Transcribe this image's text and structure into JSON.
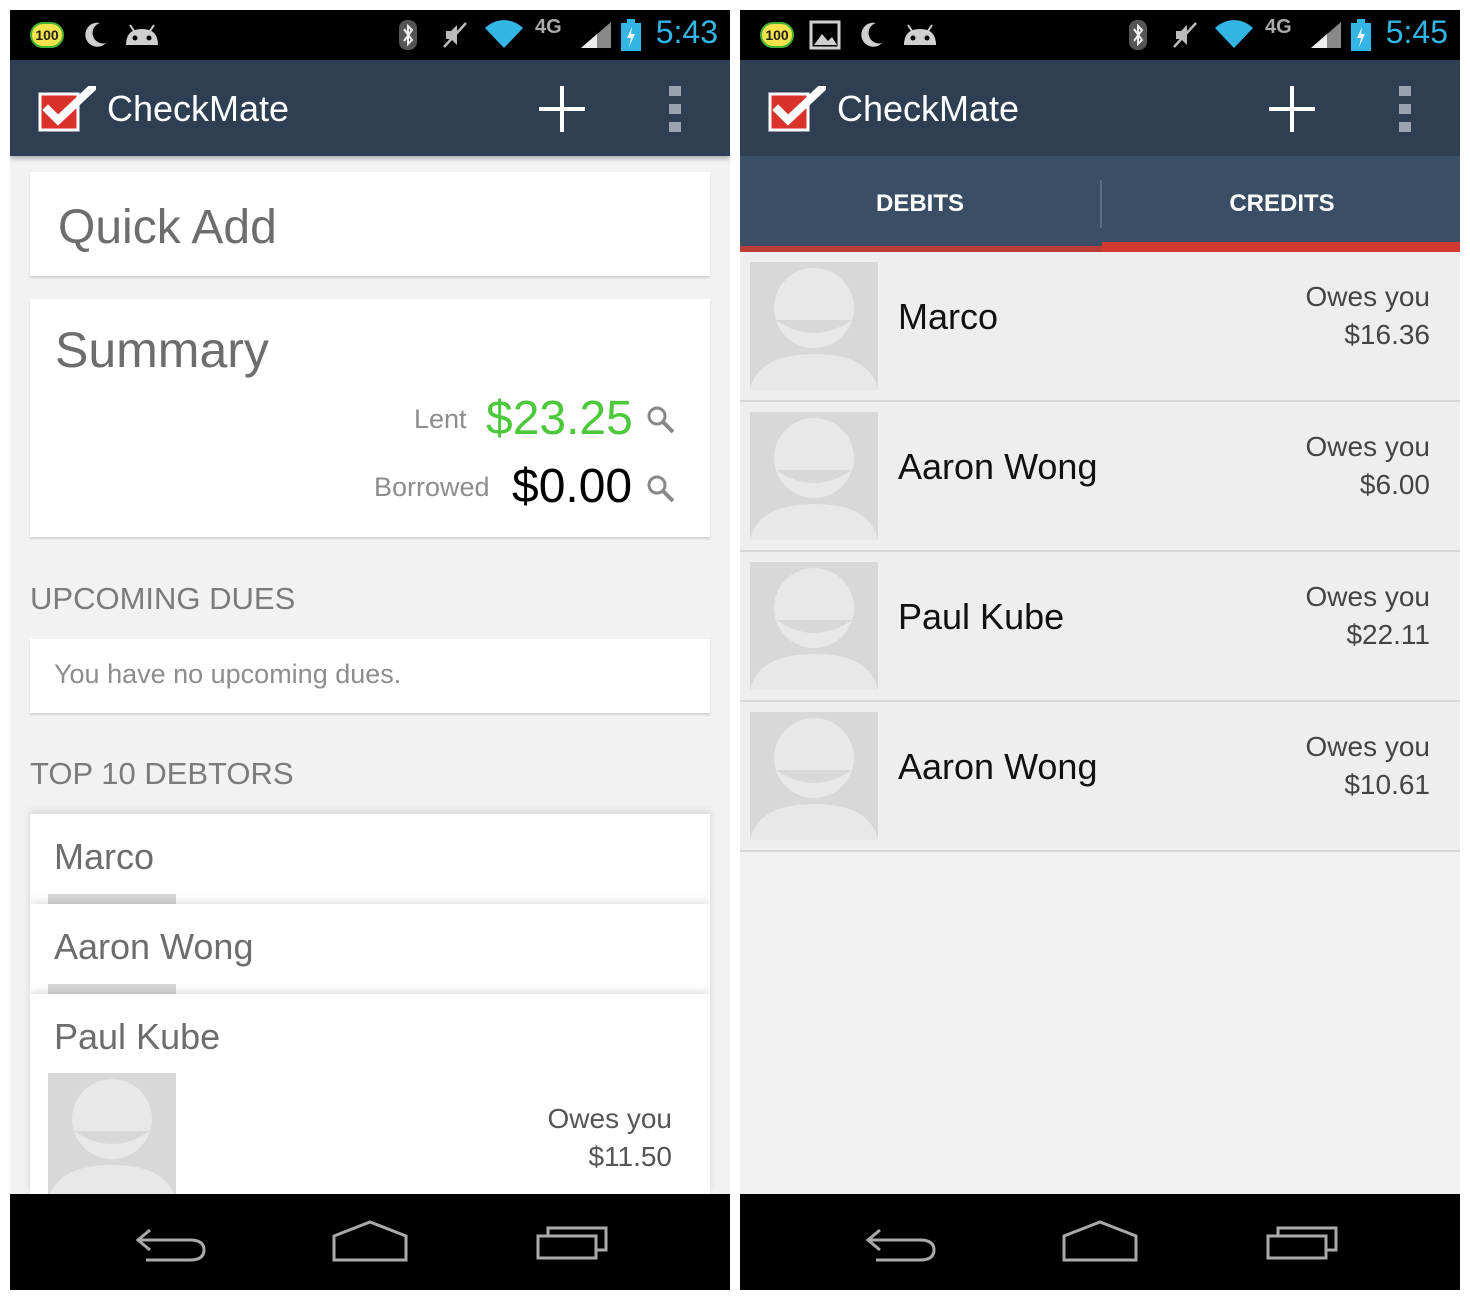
{
  "left": {
    "statusbar": {
      "badge": "100",
      "net": "4G",
      "time": "5:43"
    },
    "actionbar": {
      "title": "CheckMate"
    },
    "quick_add": "Quick Add",
    "summary": {
      "title": "Summary",
      "lent_label": "Lent",
      "lent_value": "$23.25",
      "borrowed_label": "Borrowed",
      "borrowed_value": "$0.00"
    },
    "upcoming": {
      "title": "UPCOMING DUES",
      "empty_text": "You have no upcoming dues."
    },
    "top_debtors": {
      "title": "TOP 10 DEBTORS",
      "items": [
        {
          "name": "Marco"
        },
        {
          "name": "Aaron Wong"
        },
        {
          "name": "Paul Kube",
          "owes_label": "Owes you",
          "amount": "$11.50"
        }
      ]
    }
  },
  "right": {
    "statusbar": {
      "badge": "100",
      "net": "4G",
      "time": "5:45"
    },
    "actionbar": {
      "title": "CheckMate"
    },
    "tabs": {
      "debits": "DEBITS",
      "credits": "CREDITS"
    },
    "items": [
      {
        "name": "Marco",
        "owes_label": "Owes you",
        "amount": "$16.36"
      },
      {
        "name": "Aaron Wong",
        "owes_label": "Owes you",
        "amount": "$6.00"
      },
      {
        "name": "Paul Kube",
        "owes_label": "Owes you",
        "amount": "$22.11"
      },
      {
        "name": "Aaron Wong",
        "owes_label": "Owes you",
        "amount": "$10.61"
      }
    ]
  },
  "colors": {
    "actionbar": "#2e3f53",
    "tabs": "#3a4f66",
    "tab_indicator": "#d2382e",
    "lent_green": "#4cc93a",
    "time_blue": "#33b5e5"
  }
}
